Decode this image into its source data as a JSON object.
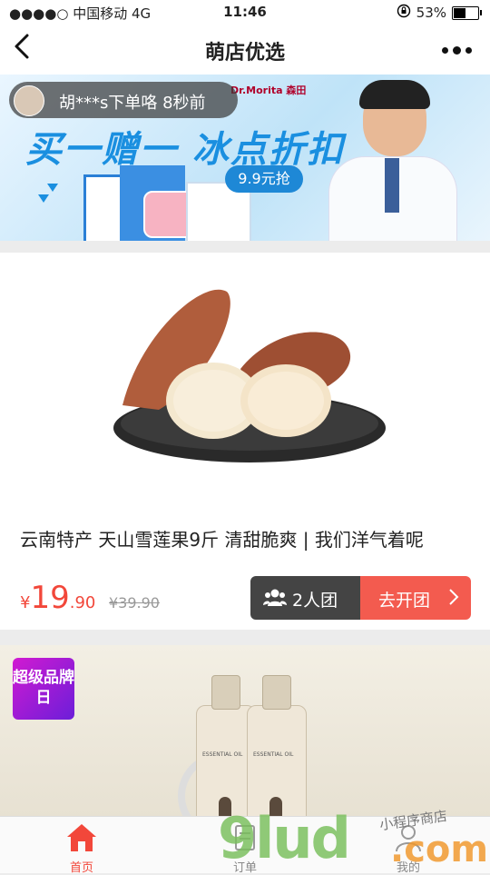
{
  "status_bar": {
    "carrier": "●●●●○ 中国移动  4G",
    "time": "11:46",
    "battery": "53%",
    "battery_level": 0.53
  },
  "nav": {
    "title": "萌店优选"
  },
  "banner": {
    "brand": "Dr.Morita 森田",
    "headline": "买一赠一 冰点折扣",
    "price_tag": "9.9元抢"
  },
  "toast": {
    "message": "胡***s下单咯  8秒前"
  },
  "product": {
    "title": "云南特产 天山雪莲果9斤 清甜脆爽 | 我们洋气着呢",
    "currency": "¥",
    "price_int": "19",
    "price_dec": ".90",
    "original_price": "¥39.90",
    "group_label": "2人团",
    "open_label": "去开团"
  },
  "product2": {
    "badge": "超级品牌日"
  },
  "tabs": [
    {
      "label": "首页"
    },
    {
      "label": "订单"
    },
    {
      "label": "我的"
    }
  ],
  "watermark": {
    "main": "9lud",
    "dot": ".com",
    "script": "小程序商店"
  },
  "colors": {
    "accent": "#f2473a",
    "dark_button": "#444444",
    "open_button": "#f35b4f"
  }
}
